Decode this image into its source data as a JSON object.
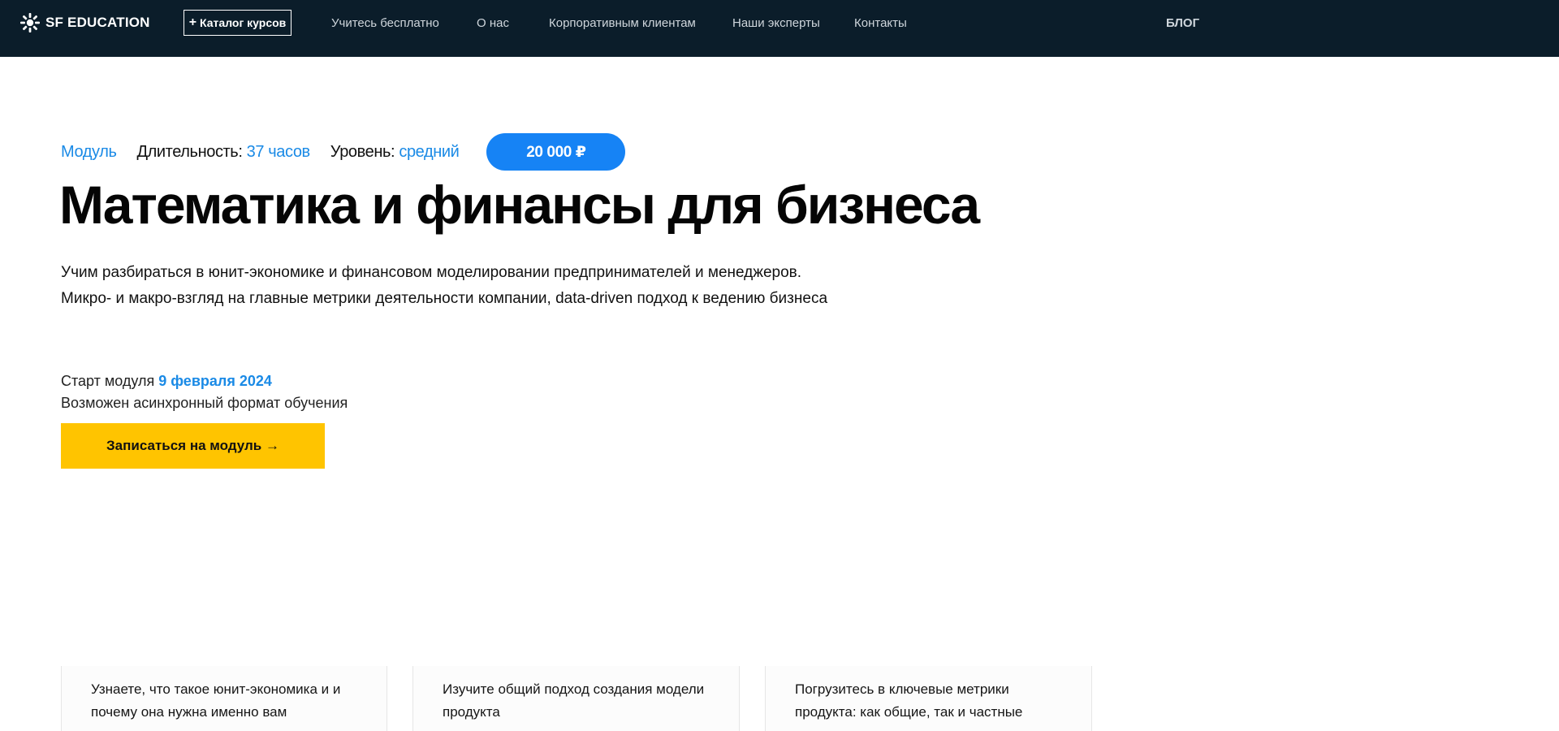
{
  "header": {
    "brand": "SF EDUCATION",
    "catalog_label": "Каталог курсов",
    "nav": [
      {
        "label": "Учитесь бесплатно"
      },
      {
        "label": "О нас"
      },
      {
        "label": "Корпоративным клиентам"
      },
      {
        "label": "Наши эксперты"
      },
      {
        "label": "Контакты"
      }
    ],
    "blog_label": "БЛОГ"
  },
  "course": {
    "type": "Модуль",
    "duration_label": "Длительность:",
    "duration_value": "37 часов",
    "level_label": "Уровень:",
    "level_value": "средний",
    "price": "20 000 ₽",
    "title": "Математика и финансы для бизнеса",
    "description_line1": "Учим разбираться в юнит-экономике и финансовом моделировании предпринимателей и менеджеров.",
    "description_line2": "Микро- и макро-взгляд на главные метрики деятельности компании, data-driven подход к ведению бизнеса",
    "start_label": "Старт модуля",
    "start_date": "9 февраля 2024",
    "async_note": "Возможен асинхронный формат обучения",
    "enroll_button": "Записаться на модуль →"
  },
  "features": [
    {
      "text": "Узнаете, что такое юнит-экономика и и почему она нужна именно вам"
    },
    {
      "text": "Изучите общий подход создания модели продукта"
    },
    {
      "text": "Погрузитесь в ключевые метрики продукта: как общие, так и частные"
    }
  ],
  "colors": {
    "header_bg": "#0b1d2a",
    "accent_blue": "#1a8ae6",
    "price_pill": "#1683f5",
    "enroll_button": "#ffc400"
  },
  "icons": {
    "logo": "sf-education-logo-icon",
    "catalog": "plus-icon"
  }
}
